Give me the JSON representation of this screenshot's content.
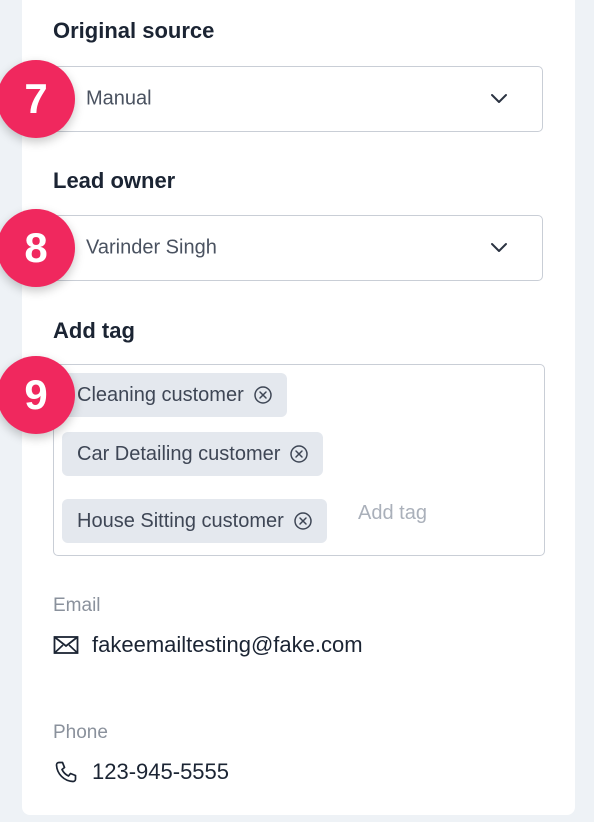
{
  "original_source": {
    "label": "Original source",
    "value": "Manual",
    "step": "7",
    "icon": "chevron-down-icon"
  },
  "lead_owner": {
    "label": "Lead owner",
    "value": "Varinder Singh",
    "step": "8",
    "icon": "chevron-down-icon"
  },
  "add_tag": {
    "label": "Add tag",
    "step": "9",
    "tags": [
      "Cleaning customer",
      "Car Detailing customer",
      "House Sitting customer"
    ],
    "input_placeholder": "Add tag",
    "remove_icon": "circle-x-icon"
  },
  "email": {
    "label": "Email",
    "value": "fakeemailtesting@fake.com",
    "icon": "envelope-icon"
  },
  "phone": {
    "label": "Phone",
    "value": "123-945-5555",
    "icon": "phone-icon"
  },
  "colors": {
    "step_badge": "#f0285e",
    "tag_background": "#e4e8ee",
    "page_background": "#eef2f6"
  }
}
